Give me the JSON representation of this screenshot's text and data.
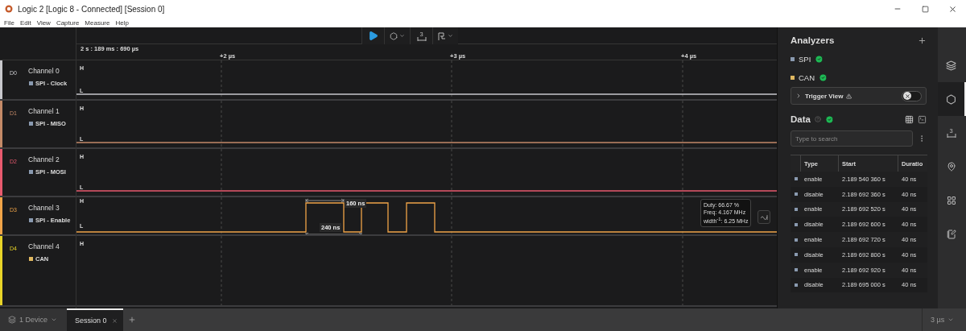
{
  "window": {
    "title": "Logic 2 [Logic 8 - Connected] [Session 0]"
  },
  "menu": [
    "File",
    "Edit",
    "View",
    "Capture",
    "Measure",
    "Help"
  ],
  "toolbar": {
    "measure_count": "3"
  },
  "ruler": {
    "origin": "2 s : 189 ms : 690 µs",
    "ticks": [
      "+2 µs",
      "+3 µs",
      "+4 µs"
    ]
  },
  "channels": [
    {
      "id": "D0",
      "name": "Channel 0",
      "color": "#c8c8cc",
      "kind": "low",
      "tag": {
        "label": "SPI - Clock",
        "color": "#8a9ab0"
      },
      "high_label": "H",
      "low_label": "L"
    },
    {
      "id": "D1",
      "name": "Channel 1",
      "color": "#c48a68",
      "kind": "low",
      "tag": {
        "label": "SPI - MISO",
        "color": "#8a9ab0"
      },
      "high_label": "H",
      "low_label": "L"
    },
    {
      "id": "D2",
      "name": "Channel 2",
      "color": "#e85a6e",
      "kind": "low",
      "tag": {
        "label": "SPI - MOSI",
        "color": "#8a9ab0"
      },
      "high_label": "H",
      "low_label": "L"
    },
    {
      "id": "D3",
      "name": "Channel 3",
      "color": "#f0a448",
      "kind": "pulses",
      "tag": {
        "label": "SPI - Enable",
        "color": "#8a9ab0"
      },
      "high_label": "H",
      "low_label": "L",
      "measurements": [
        {
          "kind": "width",
          "label": "160 ns"
        },
        {
          "kind": "period",
          "label": "240 ns"
        }
      ],
      "tooltip": [
        "Duty: 66.67 %",
        "Freq: 4.167 MHz",
        "width$^{-1}$: 6.25 MHz"
      ]
    },
    {
      "id": "D4",
      "name": "Channel 4",
      "color": "#e8d428",
      "kind": "none",
      "tag": {
        "label": "CAN",
        "color": "#e0b860"
      },
      "high_label": "H"
    }
  ],
  "analyzers": {
    "title": "Analyzers",
    "items": [
      {
        "name": "SPI",
        "color": "#8a9ab0",
        "ok": true
      },
      {
        "name": "CAN",
        "color": "#e0b860",
        "ok": true
      }
    ],
    "trigger_view": {
      "label": "Trigger View",
      "expanded": false,
      "on": false
    }
  },
  "data": {
    "title": "Data",
    "ok": true,
    "search_placeholder": "Type to search",
    "columns": [
      "Type",
      "Start",
      "Duratio"
    ],
    "rows": [
      {
        "type": "enable",
        "start": "2.189 540 360 s",
        "duration": "40 ns"
      },
      {
        "type": "disable",
        "start": "2.189 692 360 s",
        "duration": "40 ns"
      },
      {
        "type": "enable",
        "start": "2.189 692 520 s",
        "duration": "40 ns"
      },
      {
        "type": "disable",
        "start": "2.189 692 600 s",
        "duration": "40 ns"
      },
      {
        "type": "enable",
        "start": "2.189 692 720 s",
        "duration": "40 ns"
      },
      {
        "type": "disable",
        "start": "2.189 692 800 s",
        "duration": "40 ns"
      },
      {
        "type": "enable",
        "start": "2.189 692 920 s",
        "duration": "40 ns"
      },
      {
        "type": "disable",
        "start": "2.189 695 000 s",
        "duration": "40 ns"
      }
    ]
  },
  "rail": [
    {
      "kind": "layers",
      "selected": false
    },
    {
      "kind": "analyzers",
      "selected": true
    },
    {
      "kind": "ruler",
      "label": "3",
      "selected": false
    },
    {
      "kind": "marker",
      "selected": false
    },
    {
      "kind": "extensions",
      "selected": false
    },
    {
      "kind": "notes",
      "selected": false
    }
  ],
  "bottom": {
    "device": "1 Device",
    "tabs": [
      {
        "label": "Session 0",
        "selected": true
      }
    ],
    "zoom": "3 µs"
  }
}
